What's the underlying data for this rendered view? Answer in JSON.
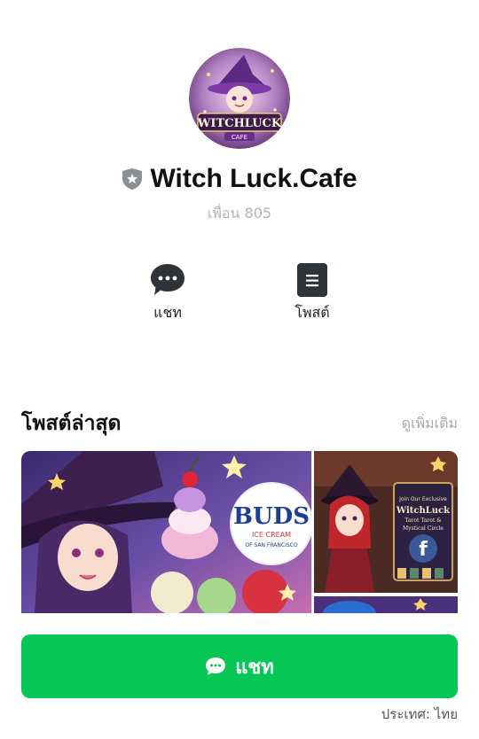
{
  "profile": {
    "name": "Witch Luck.Cafe",
    "friends": "เพื่อน 805",
    "logo_line1": "WITCHLUCK",
    "logo_line2": "CAFE"
  },
  "actions": [
    {
      "label": "แชท",
      "icon": "chat-bubble-icon"
    },
    {
      "label": "โพสต์",
      "icon": "document-icon"
    }
  ],
  "posts": {
    "heading": "โพสต์ล่าสุด",
    "see_more": "ดูเพิ่มเติม",
    "featured_brand_1": "BUDS",
    "featured_brand_2": "ICE CREAM",
    "featured_brand_3": "OF SAN FRANCISCO",
    "side_text_1": "Join Our Exclusive",
    "side_text_2": "WitchLuck",
    "side_text_3": "Tarot Tarot &",
    "side_text_4": "Mystical Circle"
  },
  "chat_button": {
    "label": "แชท"
  },
  "footer": {
    "country_label": "ประเทศ:",
    "country_value": "ไทย"
  },
  "colors": {
    "accent": "#06c755",
    "badge": "#8a8f96",
    "muted": "#b4b4b4"
  }
}
